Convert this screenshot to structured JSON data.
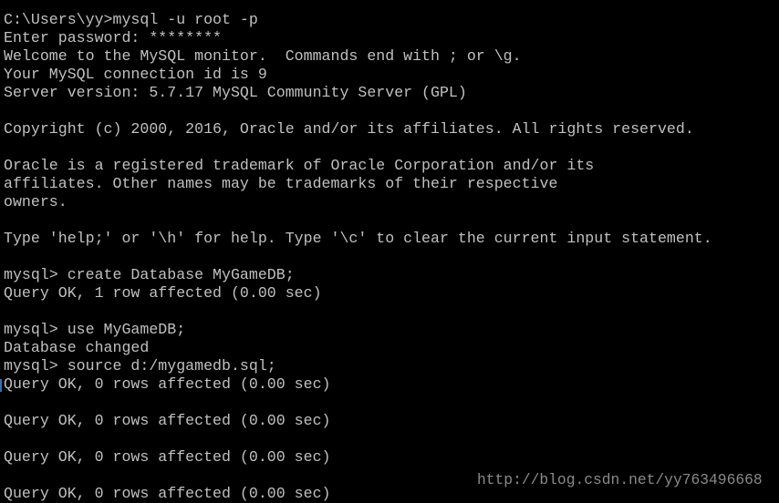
{
  "console": {
    "lines": [
      "C:\\Users\\yy>mysql -u root -p",
      "Enter password: ********",
      "Welcome to the MySQL monitor.  Commands end with ; or \\g.",
      "Your MySQL connection id is 9",
      "Server version: 5.7.17 MySQL Community Server (GPL)",
      "",
      "Copyright (c) 2000, 2016, Oracle and/or its affiliates. All rights reserved.",
      "",
      "Oracle is a registered trademark of Oracle Corporation and/or its",
      "affiliates. Other names may be trademarks of their respective",
      "owners.",
      "",
      "Type 'help;' or '\\h' for help. Type '\\c' to clear the current input statement.",
      "",
      "mysql> create Database MyGameDB;",
      "Query OK, 1 row affected (0.00 sec)",
      "",
      "mysql> use MyGameDB;",
      "Database changed",
      "mysql> source d:/mygamedb.sql;",
      "Query OK, 0 rows affected (0.00 sec)",
      "",
      "Query OK, 0 rows affected (0.00 sec)",
      "",
      "Query OK, 0 rows affected (0.00 sec)",
      "",
      "Query OK, 0 rows affected (0.00 sec)"
    ]
  },
  "watermark": "http://blog.csdn.net/yy763496668",
  "colors": {
    "background": "#000000",
    "text": "#c0c0c0",
    "watermark": "#8a8a8a"
  }
}
